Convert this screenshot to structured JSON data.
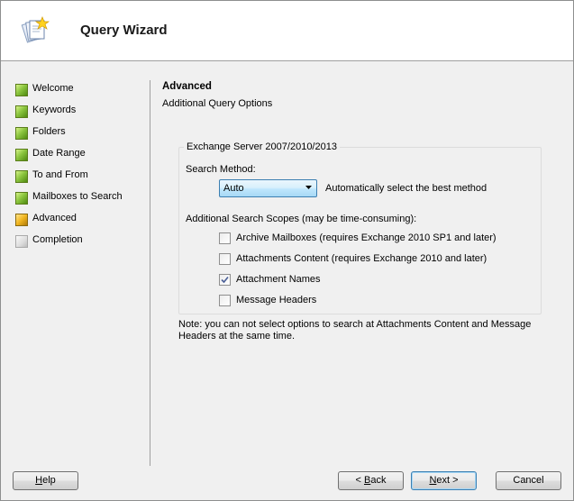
{
  "window": {
    "title": "Query Wizard"
  },
  "steps": [
    {
      "label": "Welcome",
      "state": "done"
    },
    {
      "label": "Keywords",
      "state": "done"
    },
    {
      "label": "Folders",
      "state": "done"
    },
    {
      "label": "Date Range",
      "state": "done"
    },
    {
      "label": "To and From",
      "state": "done"
    },
    {
      "label": "Mailboxes to Search",
      "state": "done"
    },
    {
      "label": "Advanced",
      "state": "current"
    },
    {
      "label": "Completion",
      "state": "pending"
    }
  ],
  "section": {
    "title": "Advanced",
    "subtitle": "Additional Query Options"
  },
  "group": {
    "legend": "Exchange Server 2007/2010/2013",
    "search_method_label": "Search Method:",
    "search_method_value": "Auto",
    "search_method_hint": "Automatically select the best method",
    "scopes_label": "Additional Search Scopes (may be time-consuming):",
    "options": [
      {
        "label": "Archive Mailboxes (requires Exchange 2010 SP1 and later)",
        "checked": false
      },
      {
        "label": "Attachments Content (requires Exchange 2010 and later)",
        "checked": false
      },
      {
        "label": "Attachment Names",
        "checked": true
      },
      {
        "label": "Message Headers",
        "checked": false
      }
    ]
  },
  "note": "Note: you can not select options to search at Attachments Content and Message Headers at the same time.",
  "buttons": {
    "help": {
      "mnemonic": "H",
      "rest": "elp"
    },
    "back": {
      "prefix": "< ",
      "mnemonic": "B",
      "rest": "ack"
    },
    "next": {
      "mnemonic": "N",
      "rest": "ext >"
    },
    "cancel": "Cancel"
  },
  "colors": {
    "step_done": "#8cc63f",
    "step_current": "#f0b51f",
    "step_pending": "#dcdcdc",
    "accent_border": "#3c7fb1"
  },
  "icons": {
    "wizard": "wizard-pages-star-icon",
    "combo_arrow": "chevron-down-icon",
    "check": "checkmark-icon"
  }
}
